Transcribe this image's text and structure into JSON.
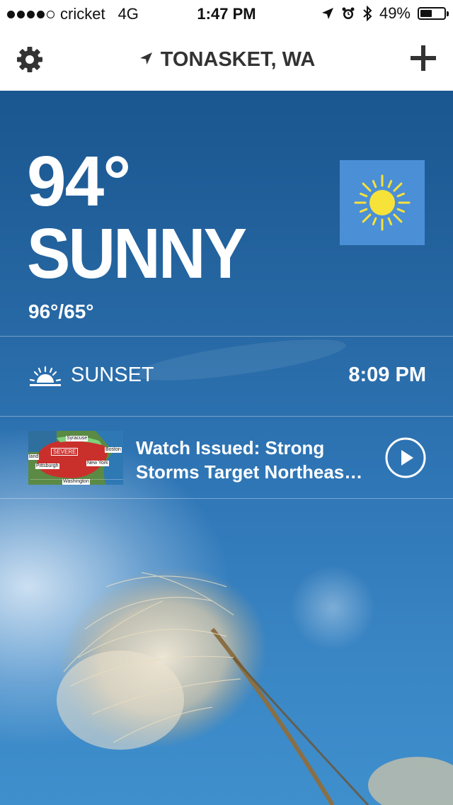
{
  "status_bar": {
    "carrier": "cricket",
    "network": "4G",
    "time": "1:47 PM",
    "battery": "49%",
    "battery_level": 0.49,
    "signal_bars": 4
  },
  "nav": {
    "location": "TONASKET, WA",
    "settings_icon": "gear-icon",
    "add_icon": "plus-icon",
    "location_icon": "location-arrow-icon"
  },
  "current": {
    "temperature": "94°",
    "condition": "SUNNY",
    "hi_lo": "96°/65°",
    "condition_icon": "sun-icon"
  },
  "sunset": {
    "label": "SUNSET",
    "time": "8:09 PM"
  },
  "news": {
    "title": "Watch Issued: Strong Storms Target Northeas…",
    "thumbnail_labels": {
      "severe": "SEVERE",
      "syracuse": "Syracuse",
      "boston": "Boston",
      "pittsburgh": "Pittsburgh",
      "new_york": "New York",
      "washington": "Washington",
      "cleveland_partial": "land"
    }
  },
  "colors": {
    "sky_top": "#1a5690",
    "sky_bottom": "#3f8fcd",
    "sun_tile": "#4b8fd6",
    "sun": "#f7e23a"
  }
}
